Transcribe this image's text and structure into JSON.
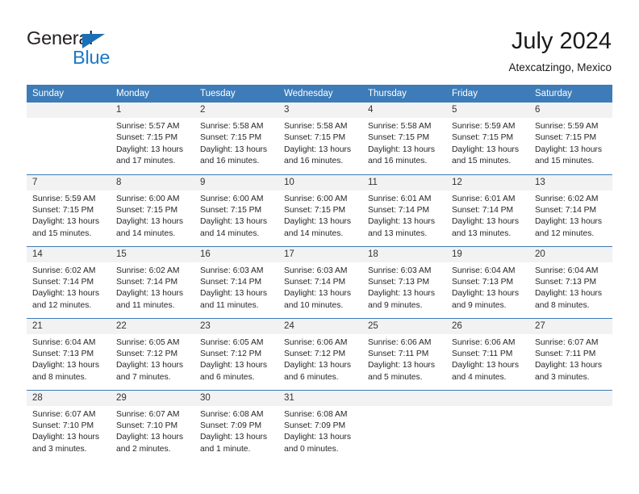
{
  "brand": {
    "name_dark": "General",
    "name_blue": "Blue",
    "accent_color": "#1b79c9",
    "triangle_color": "#1a6fb5"
  },
  "header": {
    "title": "July 2024",
    "subtitle": "Atexcatzingo, Mexico"
  },
  "theme": {
    "header_row_bg": "#3d7cb8",
    "daynum_bg": "#f2f2f2",
    "grid_line": "#3d7cb8",
    "text": "#262626"
  },
  "weekday_headers": [
    "Sunday",
    "Monday",
    "Tuesday",
    "Wednesday",
    "Thursday",
    "Friday",
    "Saturday"
  ],
  "weeks": [
    {
      "days": [
        {
          "date": "",
          "empty": true,
          "sunrise": "",
          "sunset": "",
          "daylight_line1": "",
          "daylight_line2": ""
        },
        {
          "date": "1",
          "empty": false,
          "sunrise": "Sunrise: 5:57 AM",
          "sunset": "Sunset: 7:15 PM",
          "daylight_line1": "Daylight: 13 hours",
          "daylight_line2": "and 17 minutes."
        },
        {
          "date": "2",
          "empty": false,
          "sunrise": "Sunrise: 5:58 AM",
          "sunset": "Sunset: 7:15 PM",
          "daylight_line1": "Daylight: 13 hours",
          "daylight_line2": "and 16 minutes."
        },
        {
          "date": "3",
          "empty": false,
          "sunrise": "Sunrise: 5:58 AM",
          "sunset": "Sunset: 7:15 PM",
          "daylight_line1": "Daylight: 13 hours",
          "daylight_line2": "and 16 minutes."
        },
        {
          "date": "4",
          "empty": false,
          "sunrise": "Sunrise: 5:58 AM",
          "sunset": "Sunset: 7:15 PM",
          "daylight_line1": "Daylight: 13 hours",
          "daylight_line2": "and 16 minutes."
        },
        {
          "date": "5",
          "empty": false,
          "sunrise": "Sunrise: 5:59 AM",
          "sunset": "Sunset: 7:15 PM",
          "daylight_line1": "Daylight: 13 hours",
          "daylight_line2": "and 15 minutes."
        },
        {
          "date": "6",
          "empty": false,
          "sunrise": "Sunrise: 5:59 AM",
          "sunset": "Sunset: 7:15 PM",
          "daylight_line1": "Daylight: 13 hours",
          "daylight_line2": "and 15 minutes."
        }
      ]
    },
    {
      "days": [
        {
          "date": "7",
          "empty": false,
          "sunrise": "Sunrise: 5:59 AM",
          "sunset": "Sunset: 7:15 PM",
          "daylight_line1": "Daylight: 13 hours",
          "daylight_line2": "and 15 minutes."
        },
        {
          "date": "8",
          "empty": false,
          "sunrise": "Sunrise: 6:00 AM",
          "sunset": "Sunset: 7:15 PM",
          "daylight_line1": "Daylight: 13 hours",
          "daylight_line2": "and 14 minutes."
        },
        {
          "date": "9",
          "empty": false,
          "sunrise": "Sunrise: 6:00 AM",
          "sunset": "Sunset: 7:15 PM",
          "daylight_line1": "Daylight: 13 hours",
          "daylight_line2": "and 14 minutes."
        },
        {
          "date": "10",
          "empty": false,
          "sunrise": "Sunrise: 6:00 AM",
          "sunset": "Sunset: 7:15 PM",
          "daylight_line1": "Daylight: 13 hours",
          "daylight_line2": "and 14 minutes."
        },
        {
          "date": "11",
          "empty": false,
          "sunrise": "Sunrise: 6:01 AM",
          "sunset": "Sunset: 7:14 PM",
          "daylight_line1": "Daylight: 13 hours",
          "daylight_line2": "and 13 minutes."
        },
        {
          "date": "12",
          "empty": false,
          "sunrise": "Sunrise: 6:01 AM",
          "sunset": "Sunset: 7:14 PM",
          "daylight_line1": "Daylight: 13 hours",
          "daylight_line2": "and 13 minutes."
        },
        {
          "date": "13",
          "empty": false,
          "sunrise": "Sunrise: 6:02 AM",
          "sunset": "Sunset: 7:14 PM",
          "daylight_line1": "Daylight: 13 hours",
          "daylight_line2": "and 12 minutes."
        }
      ]
    },
    {
      "days": [
        {
          "date": "14",
          "empty": false,
          "sunrise": "Sunrise: 6:02 AM",
          "sunset": "Sunset: 7:14 PM",
          "daylight_line1": "Daylight: 13 hours",
          "daylight_line2": "and 12 minutes."
        },
        {
          "date": "15",
          "empty": false,
          "sunrise": "Sunrise: 6:02 AM",
          "sunset": "Sunset: 7:14 PM",
          "daylight_line1": "Daylight: 13 hours",
          "daylight_line2": "and 11 minutes."
        },
        {
          "date": "16",
          "empty": false,
          "sunrise": "Sunrise: 6:03 AM",
          "sunset": "Sunset: 7:14 PM",
          "daylight_line1": "Daylight: 13 hours",
          "daylight_line2": "and 11 minutes."
        },
        {
          "date": "17",
          "empty": false,
          "sunrise": "Sunrise: 6:03 AM",
          "sunset": "Sunset: 7:14 PM",
          "daylight_line1": "Daylight: 13 hours",
          "daylight_line2": "and 10 minutes."
        },
        {
          "date": "18",
          "empty": false,
          "sunrise": "Sunrise: 6:03 AM",
          "sunset": "Sunset: 7:13 PM",
          "daylight_line1": "Daylight: 13 hours",
          "daylight_line2": "and 9 minutes."
        },
        {
          "date": "19",
          "empty": false,
          "sunrise": "Sunrise: 6:04 AM",
          "sunset": "Sunset: 7:13 PM",
          "daylight_line1": "Daylight: 13 hours",
          "daylight_line2": "and 9 minutes."
        },
        {
          "date": "20",
          "empty": false,
          "sunrise": "Sunrise: 6:04 AM",
          "sunset": "Sunset: 7:13 PM",
          "daylight_line1": "Daylight: 13 hours",
          "daylight_line2": "and 8 minutes."
        }
      ]
    },
    {
      "days": [
        {
          "date": "21",
          "empty": false,
          "sunrise": "Sunrise: 6:04 AM",
          "sunset": "Sunset: 7:13 PM",
          "daylight_line1": "Daylight: 13 hours",
          "daylight_line2": "and 8 minutes."
        },
        {
          "date": "22",
          "empty": false,
          "sunrise": "Sunrise: 6:05 AM",
          "sunset": "Sunset: 7:12 PM",
          "daylight_line1": "Daylight: 13 hours",
          "daylight_line2": "and 7 minutes."
        },
        {
          "date": "23",
          "empty": false,
          "sunrise": "Sunrise: 6:05 AM",
          "sunset": "Sunset: 7:12 PM",
          "daylight_line1": "Daylight: 13 hours",
          "daylight_line2": "and 6 minutes."
        },
        {
          "date": "24",
          "empty": false,
          "sunrise": "Sunrise: 6:06 AM",
          "sunset": "Sunset: 7:12 PM",
          "daylight_line1": "Daylight: 13 hours",
          "daylight_line2": "and 6 minutes."
        },
        {
          "date": "25",
          "empty": false,
          "sunrise": "Sunrise: 6:06 AM",
          "sunset": "Sunset: 7:11 PM",
          "daylight_line1": "Daylight: 13 hours",
          "daylight_line2": "and 5 minutes."
        },
        {
          "date": "26",
          "empty": false,
          "sunrise": "Sunrise: 6:06 AM",
          "sunset": "Sunset: 7:11 PM",
          "daylight_line1": "Daylight: 13 hours",
          "daylight_line2": "and 4 minutes."
        },
        {
          "date": "27",
          "empty": false,
          "sunrise": "Sunrise: 6:07 AM",
          "sunset": "Sunset: 7:11 PM",
          "daylight_line1": "Daylight: 13 hours",
          "daylight_line2": "and 3 minutes."
        }
      ]
    },
    {
      "days": [
        {
          "date": "28",
          "empty": false,
          "sunrise": "Sunrise: 6:07 AM",
          "sunset": "Sunset: 7:10 PM",
          "daylight_line1": "Daylight: 13 hours",
          "daylight_line2": "and 3 minutes."
        },
        {
          "date": "29",
          "empty": false,
          "sunrise": "Sunrise: 6:07 AM",
          "sunset": "Sunset: 7:10 PM",
          "daylight_line1": "Daylight: 13 hours",
          "daylight_line2": "and 2 minutes."
        },
        {
          "date": "30",
          "empty": false,
          "sunrise": "Sunrise: 6:08 AM",
          "sunset": "Sunset: 7:09 PM",
          "daylight_line1": "Daylight: 13 hours",
          "daylight_line2": "and 1 minute."
        },
        {
          "date": "31",
          "empty": false,
          "sunrise": "Sunrise: 6:08 AM",
          "sunset": "Sunset: 7:09 PM",
          "daylight_line1": "Daylight: 13 hours",
          "daylight_line2": "and 0 minutes."
        },
        {
          "date": "",
          "empty": true,
          "sunrise": "",
          "sunset": "",
          "daylight_line1": "",
          "daylight_line2": ""
        },
        {
          "date": "",
          "empty": true,
          "sunrise": "",
          "sunset": "",
          "daylight_line1": "",
          "daylight_line2": ""
        },
        {
          "date": "",
          "empty": true,
          "sunrise": "",
          "sunset": "",
          "daylight_line1": "",
          "daylight_line2": ""
        }
      ]
    }
  ]
}
